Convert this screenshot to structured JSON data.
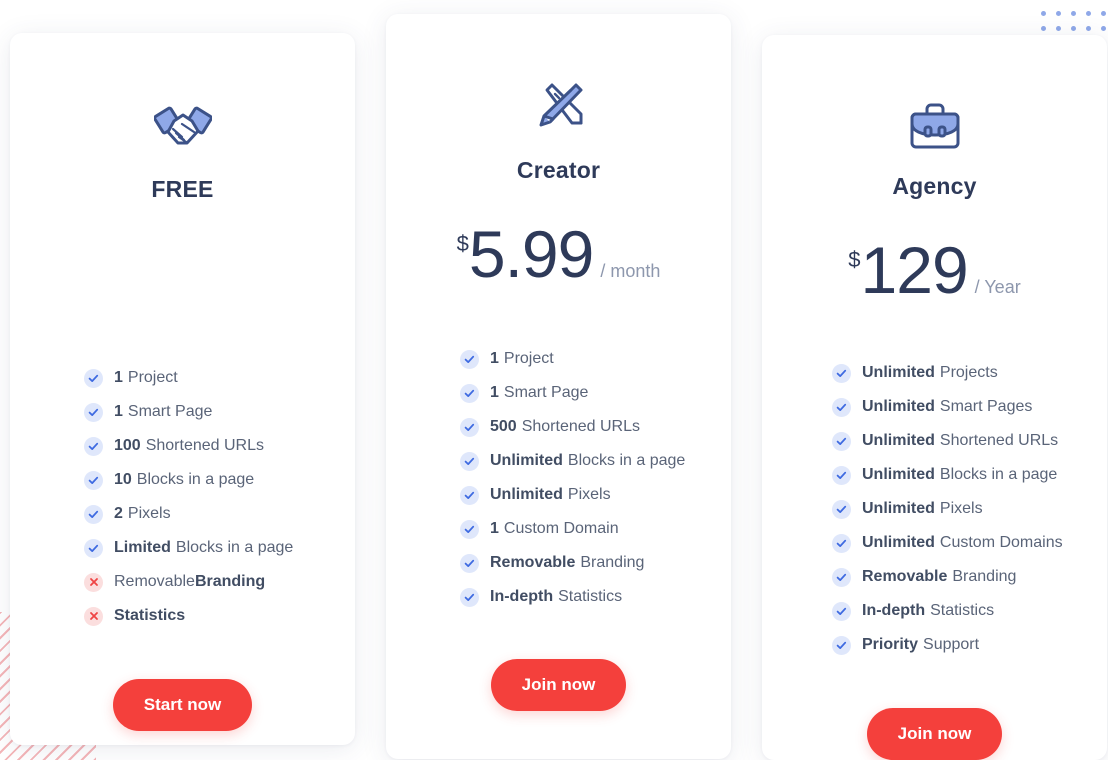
{
  "decor": {
    "dots_color": "#8fa8e8",
    "stripes_color": "#f3a9ac",
    "dot_rows": 2,
    "dot_cols": 6
  },
  "theme": {
    "accent_red": "#f4403c",
    "icon_blue": "#8fa8e8",
    "icon_outline": "#3c5288",
    "text_dark": "#2e3a59",
    "text_muted": "#5a6478",
    "check_bg": "#dfe7fb",
    "cross_bg": "#fbdede"
  },
  "plans": [
    {
      "id": "free",
      "name": "FREE",
      "icon": "handshake-icon",
      "currency": "",
      "amount": "",
      "period": "",
      "has_price": false,
      "features": [
        {
          "strong": "1",
          "text": "Project",
          "text_bold": false,
          "available": true
        },
        {
          "strong": "1",
          "text": "Smart Page",
          "text_bold": false,
          "available": true
        },
        {
          "strong": "100",
          "text": "Shortened URLs",
          "text_bold": false,
          "available": true
        },
        {
          "strong": "10",
          "text": "Blocks in a page",
          "text_bold": false,
          "available": true
        },
        {
          "strong": "2",
          "text": "Pixels",
          "text_bold": false,
          "available": true
        },
        {
          "strong": "Limited",
          "text": "Blocks in a page",
          "text_bold": false,
          "available": true
        },
        {
          "strong": "",
          "text": "Removable ",
          "text_bold": false,
          "trailing_bold": "Branding",
          "available": false
        },
        {
          "strong": "Statistics",
          "text": "",
          "text_bold": false,
          "available": false
        }
      ],
      "cta_label": "Start now"
    },
    {
      "id": "creator",
      "name": "Creator",
      "icon": "pencil-ruler-icon",
      "currency": "$",
      "amount": "5.99",
      "period": "/ month",
      "has_price": true,
      "features": [
        {
          "strong": "1",
          "text": "Project",
          "text_bold": false,
          "available": true
        },
        {
          "strong": "1",
          "text": "Smart Page",
          "text_bold": false,
          "available": true
        },
        {
          "strong": "500",
          "text": "Shortened URLs",
          "text_bold": false,
          "available": true
        },
        {
          "strong": "Unlimited",
          "text": "Blocks in a page",
          "text_bold": false,
          "available": true
        },
        {
          "strong": "Unlimited",
          "text": "Pixels",
          "text_bold": false,
          "available": true
        },
        {
          "strong": "1",
          "text": "Custom Domain",
          "text_bold": false,
          "available": true
        },
        {
          "strong": "Removable",
          "text": "Branding",
          "text_bold": false,
          "available": true
        },
        {
          "strong": "In-depth",
          "text": "Statistics",
          "text_bold": false,
          "available": true
        }
      ],
      "cta_label": "Join now"
    },
    {
      "id": "agency",
      "name": "Agency",
      "icon": "briefcase-icon",
      "currency": "$",
      "amount": "129",
      "period": "/ Year",
      "has_price": true,
      "features": [
        {
          "strong": "Unlimited",
          "text": "Projects",
          "text_bold": false,
          "available": true
        },
        {
          "strong": "Unlimited",
          "text": "Smart Pages",
          "text_bold": false,
          "available": true
        },
        {
          "strong": "Unlimited",
          "text": "Shortened URLs",
          "text_bold": false,
          "available": true
        },
        {
          "strong": "Unlimited",
          "text": "Blocks in a page",
          "text_bold": false,
          "available": true
        },
        {
          "strong": "Unlimited",
          "text": "Pixels",
          "text_bold": false,
          "available": true
        },
        {
          "strong": "Unlimited",
          "text": "Custom Domains",
          "text_bold": false,
          "available": true
        },
        {
          "strong": "Removable",
          "text": "Branding",
          "text_bold": false,
          "available": true
        },
        {
          "strong": "In-depth",
          "text": "Statistics",
          "text_bold": false,
          "available": true
        },
        {
          "strong": "Priority",
          "text": "Support",
          "text_bold": false,
          "available": true
        }
      ],
      "cta_label": "Join now"
    }
  ]
}
